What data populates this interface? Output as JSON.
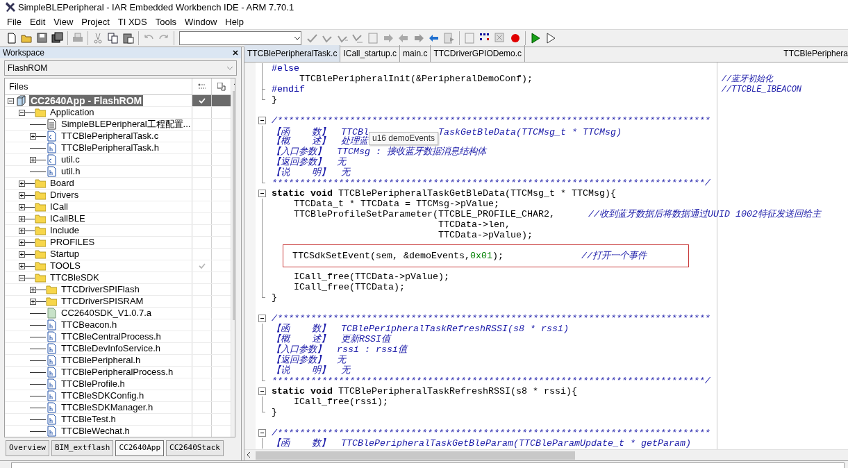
{
  "window": {
    "title": "SimpleBLEPeripheral - IAR Embedded Workbench IDE - ARM 7.70.1"
  },
  "menu": [
    "File",
    "Edit",
    "View",
    "Project",
    "TI XDS",
    "Tools",
    "Window",
    "Help"
  ],
  "workspace": {
    "title": "Workspace",
    "configuration": "FlashROM",
    "files_header": "Files",
    "tree": [
      {
        "label": "CC2640App - FlashROM",
        "kind": "project",
        "expanded": true,
        "selected": true,
        "checked": true,
        "children": [
          {
            "label": "Application",
            "kind": "folder",
            "expanded": true,
            "selected": false,
            "checked": false,
            "children": [
              {
                "label": "SimpleBLEPeripheral工程配置...",
                "kind": "doc",
                "selected": false,
                "checked": false
              },
              {
                "label": "TTCBlePeripheralTask.c",
                "kind": "c",
                "expanded": false,
                "selected": false,
                "checked": false
              },
              {
                "label": "TTCBlePeripheralTask.h",
                "kind": "h",
                "selected": false,
                "checked": false
              },
              {
                "label": "util.c",
                "kind": "c",
                "expanded": false,
                "selected": false,
                "checked": false
              },
              {
                "label": "util.h",
                "kind": "h",
                "selected": false,
                "checked": false
              }
            ]
          },
          {
            "label": "Board",
            "kind": "folder",
            "expanded": false,
            "selected": false,
            "checked": false
          },
          {
            "label": "Drivers",
            "kind": "folder",
            "expanded": false,
            "selected": false,
            "checked": false
          },
          {
            "label": "ICall",
            "kind": "folder",
            "expanded": false,
            "selected": false,
            "checked": false
          },
          {
            "label": "ICallBLE",
            "kind": "folder",
            "expanded": false,
            "selected": false,
            "checked": false
          },
          {
            "label": "Include",
            "kind": "folder",
            "expanded": false,
            "selected": false,
            "checked": false
          },
          {
            "label": "PROFILES",
            "kind": "folder",
            "expanded": false,
            "selected": false,
            "checked": false
          },
          {
            "label": "Startup",
            "kind": "folder",
            "expanded": false,
            "selected": false,
            "checked": false
          },
          {
            "label": "TOOLS",
            "kind": "folder",
            "expanded": false,
            "selected": false,
            "checked": true
          },
          {
            "label": "TTCBleSDK",
            "kind": "folder",
            "expanded": true,
            "selected": false,
            "checked": false,
            "children": [
              {
                "label": "TTCDriverSPIFlash",
                "kind": "folder",
                "expanded": false,
                "selected": false,
                "checked": false
              },
              {
                "label": "TTCDriverSPISRAM",
                "kind": "folder",
                "expanded": false,
                "selected": false,
                "checked": false
              },
              {
                "label": "CC2640SDK_V1.0.7.a",
                "kind": "lib",
                "selected": false,
                "checked": false
              },
              {
                "label": "TTCBeacon.h",
                "kind": "h",
                "selected": false,
                "checked": false
              },
              {
                "label": "TTCBleCentralProcess.h",
                "kind": "h",
                "selected": false,
                "checked": false
              },
              {
                "label": "TTCBleDevInfoService.h",
                "kind": "h",
                "selected": false,
                "checked": false
              },
              {
                "label": "TTCBlePeripheral.h",
                "kind": "h",
                "selected": false,
                "checked": false
              },
              {
                "label": "TTCBlePeripheralProcess.h",
                "kind": "h",
                "selected": false,
                "checked": false
              },
              {
                "label": "TTCBleProfile.h",
                "kind": "h",
                "selected": false,
                "checked": false
              },
              {
                "label": "TTCBleSDKConfig.h",
                "kind": "h",
                "selected": false,
                "checked": false
              },
              {
                "label": "TTCBleSDKManager.h",
                "kind": "h",
                "selected": false,
                "checked": false
              },
              {
                "label": "TTCBleTest.h",
                "kind": "h",
                "selected": false,
                "checked": false
              },
              {
                "label": "TTCBleWechat.h",
                "kind": "h",
                "selected": false,
                "checked": false
              }
            ]
          }
        ]
      }
    ],
    "tabs": [
      {
        "label": "Overview",
        "selected": false
      },
      {
        "label": "BIM_extflash",
        "selected": false
      },
      {
        "label": "CC2640App",
        "selected": true
      },
      {
        "label": "CC2640Stack",
        "selected": false
      }
    ]
  },
  "editor": {
    "tabs": [
      {
        "label": "TTCBlePeripheralTask.c",
        "selected": true
      },
      {
        "label": "ICall_startup.c",
        "selected": false
      },
      {
        "label": "main.c",
        "selected": false
      },
      {
        "label": "TTCDriverGPIODemo.c",
        "selected": false
      }
    ],
    "function_selector": "TTCBlePeriphera",
    "lines": [
      {
        "kind": "body",
        "segments": [
          {
            "kind": "preproc",
            "text": "#else"
          }
        ]
      },
      {
        "kind": "body",
        "segments": [
          {
            "kind": "plain",
            "text": "     TTCBlePeripheralInit(&PeripheralDemoConf);"
          }
        ],
        "note": "//蓝牙初始化"
      },
      {
        "kind": "tick",
        "segments": [
          {
            "kind": "preproc",
            "text": "#endif"
          }
        ],
        "note": "//TTCBLE_IBEACON"
      },
      {
        "kind": "end",
        "segments": [
          {
            "kind": "plain",
            "text": "}"
          }
        ]
      },
      {
        "kind": "blank"
      },
      {
        "kind": "fold",
        "segments": [
          {
            "kind": "comment",
            "text": "/******************************************************************************"
          }
        ]
      },
      {
        "kind": "body",
        "segments": [
          {
            "kind": "comment",
            "text": "【函    数】  TTCBl"
          },
          {
            "kind": "tooltip",
            "text": "u16 demoEvents"
          },
          {
            "kind": "comment",
            "text": "TaskGetBleData(TTCMsg_t * TTCMsg)"
          }
        ]
      },
      {
        "kind": "body",
        "segments": [
          {
            "kind": "comment",
            "text": "【概    述】  处理蓝"
          }
        ]
      },
      {
        "kind": "body",
        "segments": [
          {
            "kind": "comment",
            "text": "【入口参数】  TTCMsg : 接收蓝牙数据消息结构体"
          }
        ]
      },
      {
        "kind": "body",
        "segments": [
          {
            "kind": "comment",
            "text": "【返回参数】  无"
          }
        ]
      },
      {
        "kind": "body",
        "segments": [
          {
            "kind": "comment",
            "text": "【说    明】  无"
          }
        ]
      },
      {
        "kind": "end",
        "segments": [
          {
            "kind": "comment",
            "text": "******************************************************************************/"
          }
        ]
      },
      {
        "kind": "fold",
        "segments": [
          {
            "kind": "keyword",
            "text": "static void"
          },
          {
            "kind": "plain",
            "text": " TTCBlePeripheralTaskGetBleData(TTCMsg_t * TTCMsg){"
          }
        ]
      },
      {
        "kind": "body",
        "segments": [
          {
            "kind": "plain",
            "text": "    TTCData_t * TTCData = TTCMsg->pValue;"
          }
        ]
      },
      {
        "kind": "body",
        "segments": [
          {
            "kind": "plain",
            "text": "    TTCBleProfileSetParameter(TTCBLE_PROFILE_CHAR2,      "
          },
          {
            "kind": "comment",
            "text": "//收到蓝牙数据后将数据通过UUID 1002特征发送回给主"
          }
        ]
      },
      {
        "kind": "body",
        "segments": [
          {
            "kind": "plain",
            "text": "                              TTCData->len,"
          }
        ]
      },
      {
        "kind": "body",
        "segments": [
          {
            "kind": "plain",
            "text": "                              TTCData->pValue);"
          }
        ]
      },
      {
        "kind": "body"
      },
      {
        "kind": "body",
        "boxed": true,
        "segments": [
          {
            "kind": "plain",
            "text": "TTCSdkSetEvent(sem, &demoEvents,"
          },
          {
            "kind": "number",
            "text": "0x01"
          },
          {
            "kind": "plain",
            "text": ");              "
          },
          {
            "kind": "comment",
            "text": "//打开一个事件"
          }
        ]
      },
      {
        "kind": "body"
      },
      {
        "kind": "body",
        "segments": [
          {
            "kind": "plain",
            "text": "    ICall_free(TTCData->pValue);"
          }
        ]
      },
      {
        "kind": "body",
        "segments": [
          {
            "kind": "plain",
            "text": "    ICall_free(TTCData);"
          }
        ]
      },
      {
        "kind": "end",
        "segments": [
          {
            "kind": "plain",
            "text": "}"
          }
        ]
      },
      {
        "kind": "blank"
      },
      {
        "kind": "fold",
        "segments": [
          {
            "kind": "comment",
            "text": "/******************************************************************************"
          }
        ]
      },
      {
        "kind": "body",
        "segments": [
          {
            "kind": "comment",
            "text": "【函    数】  TCBlePeripheralTaskRefreshRSSI(s8 * rssi)"
          }
        ]
      },
      {
        "kind": "body",
        "segments": [
          {
            "kind": "comment",
            "text": "【概    述】  更新RSSI值"
          }
        ]
      },
      {
        "kind": "body",
        "segments": [
          {
            "kind": "comment",
            "text": "【入口参数】  rssi : rssi值"
          }
        ]
      },
      {
        "kind": "body",
        "segments": [
          {
            "kind": "comment",
            "text": "【返回参数】  无"
          }
        ]
      },
      {
        "kind": "body",
        "segments": [
          {
            "kind": "comment",
            "text": "【说    明】  无"
          }
        ]
      },
      {
        "kind": "end",
        "segments": [
          {
            "kind": "comment",
            "text": "******************************************************************************/"
          }
        ]
      },
      {
        "kind": "fold",
        "segments": [
          {
            "kind": "keyword",
            "text": "static void"
          },
          {
            "kind": "plain",
            "text": " TTCBlePeripheralTaskRefreshRSSI(s8 * rssi){"
          }
        ]
      },
      {
        "kind": "body",
        "segments": [
          {
            "kind": "plain",
            "text": "    ICall_free(rssi);"
          }
        ]
      },
      {
        "kind": "end",
        "segments": [
          {
            "kind": "plain",
            "text": "}"
          }
        ]
      },
      {
        "kind": "blank"
      },
      {
        "kind": "fold",
        "segments": [
          {
            "kind": "comment",
            "text": "/******************************************************************************"
          }
        ]
      },
      {
        "kind": "body",
        "segments": [
          {
            "kind": "comment",
            "text": "【函    数】  TTCBlePeripheralTaskGetBleParam(TTCBleParamUpdate_t * getParam)"
          }
        ]
      }
    ]
  }
}
